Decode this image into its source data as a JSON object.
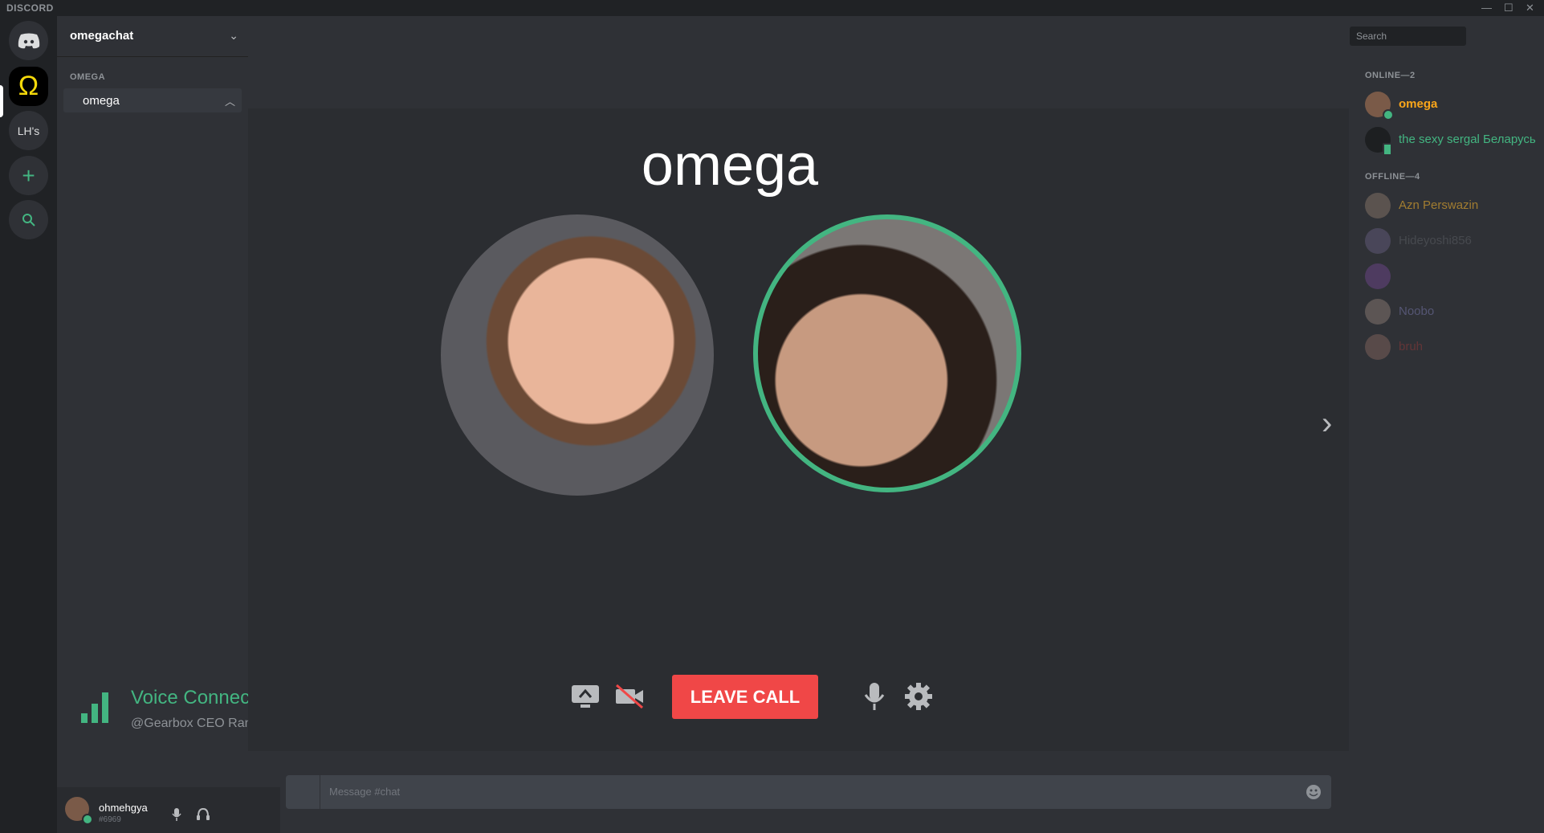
{
  "app": {
    "brand": "DISCORD"
  },
  "window_controls": {
    "minimize": "—",
    "maximize": "☐",
    "close": "✕"
  },
  "guilds": {
    "home_icon": "discord-logo-icon",
    "active_server_glyph": "Ω",
    "other_server_label": "LH's",
    "add_server_glyph": "+",
    "search_glyph": "search-icon"
  },
  "server": {
    "name": "omegachat",
    "category": "OMEGA",
    "channel": "omega"
  },
  "voice": {
    "status": "Voice Connected",
    "sub": "@Gearbox CEO Randy ..."
  },
  "user": {
    "name": "ohmehgya",
    "tag": "#6969"
  },
  "call": {
    "title": "omega",
    "leave_label": "LEAVE CALL"
  },
  "composer": {
    "placeholder": "Message #chat"
  },
  "members": {
    "search_placeholder": "Search",
    "online_title": "ONLINE—2",
    "offline_title": "OFFLINE—4",
    "online": [
      {
        "name": "omega",
        "color": "#faa61a"
      },
      {
        "name": "the sexy sergal Беларусь",
        "color": "#43b581"
      }
    ],
    "offline": [
      {
        "name": "Azn Perswazin",
        "color": "#a07b2f"
      },
      {
        "name": "Hideyoshi856",
        "color": "#3f4147"
      },
      {
        "name": "",
        "color": "#4a3a3a"
      },
      {
        "name": "Noobo",
        "color": "#5a5a8a"
      },
      {
        "name": "bruh",
        "color": "#6b2b2b"
      }
    ]
  },
  "colors": {
    "green": "#43b581",
    "red": "#f04747",
    "dark": "#202225"
  }
}
